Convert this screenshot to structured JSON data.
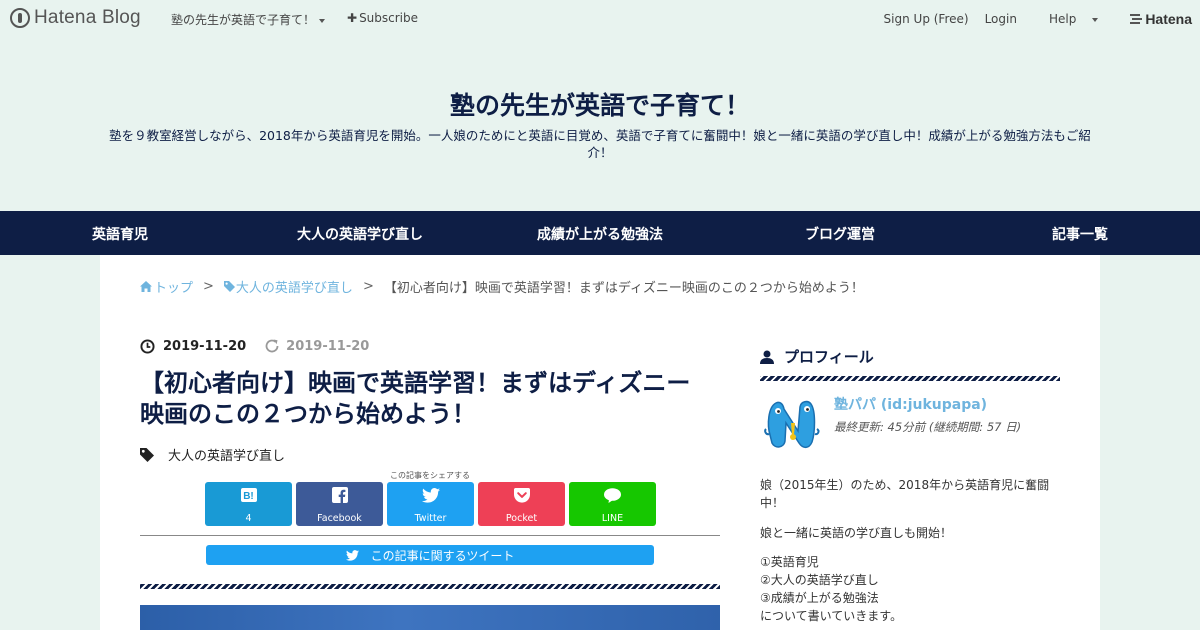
{
  "topbar": {
    "logo_text": "Hatena Blog",
    "blog_menu": "塾の先生が英語で子育て！",
    "subscribe": "Subscribe",
    "signup": "Sign Up (Free)",
    "login": "Login",
    "help": "Help",
    "hatena": "Hatena"
  },
  "header": {
    "title": "塾の先生が英語で子育て！",
    "description": "塾を９教室経営しながら、2018年から英語育児を開始。一人娘のためにと英語に目覚め、英語で子育てに奮闘中！娘と一緒に英語の学び直し中！成績が上がる勉強方法もご紹介！"
  },
  "nav": {
    "items": [
      "英語育児",
      "大人の英語学び直し",
      "成績が上がる勉強法",
      "ブログ運営",
      "記事一覧"
    ]
  },
  "breadcrumb": {
    "home": "トップ",
    "category": "大人の英語学び直し",
    "separator": ">",
    "current": "【初心者向け】映画で英語学習！まずはディズニー映画のこの２つから始めよう！"
  },
  "entry": {
    "published": "2019-11-20",
    "updated": "2019-11-20",
    "title": "【初心者向け】映画で英語学習！まずはディズニー映画のこの２つから始めよう！",
    "category": "大人の英語学び直し",
    "share_caption": "この記事をシェアする",
    "share": [
      {
        "name": "hatena",
        "label": "4"
      },
      {
        "name": "facebook",
        "label": "Facebook"
      },
      {
        "name": "twitter",
        "label": "Twitter"
      },
      {
        "name": "pocket",
        "label": "Pocket"
      },
      {
        "name": "line",
        "label": "LINE"
      }
    ],
    "tweet_bar": "この記事に関するツイート"
  },
  "sidebar": {
    "heading": "プロフィール",
    "profile_name": "塾パパ (id:jukupapa)",
    "profile_updated": "最終更新: 45分前 (継続期間: 57 日)",
    "bio": [
      "娘（2015年生）のため、2018年から英語育児に奮闘中！",
      "娘と一緒に英語の学び直しも開始！",
      "①英語育児",
      "②大人の英語学び直し",
      "③成績が上がる勉強法",
      "について書いていきます。"
    ]
  },
  "colors": {
    "navy": "#0e1e45",
    "link": "#6fb4de",
    "page_bg": "#e8f3ef",
    "hatena_bookmark": "#199ad5",
    "facebook": "#3d5a98",
    "twitter": "#1ea1f2",
    "pocket": "#ee4056",
    "line": "#16c700"
  }
}
